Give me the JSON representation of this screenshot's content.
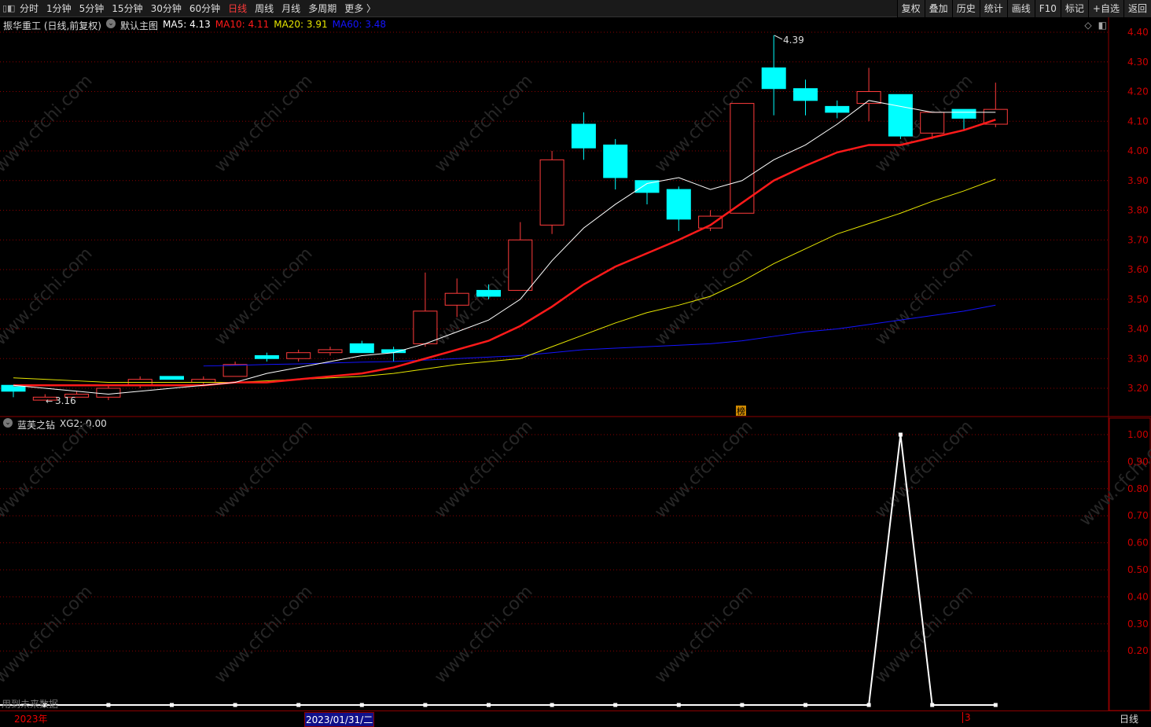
{
  "toolbar": {
    "periods": [
      "分时",
      "1分钟",
      "5分钟",
      "15分钟",
      "30分钟",
      "60分钟",
      "日线",
      "周线",
      "月线",
      "多周期",
      "更多 〉"
    ],
    "active": "日线",
    "right": [
      "复权",
      "叠加",
      "历史",
      "统计",
      "画线",
      "F10",
      "标记",
      "+自选",
      "返回"
    ]
  },
  "legend": {
    "title": "振华重工 (日线,前复权)",
    "main": "默认主图",
    "ma5": "MA5: 4.13",
    "ma10": "MA10: 4.11",
    "ma20": "MA20: 3.91",
    "ma60": "MA60: 3.48"
  },
  "colors": {
    "up": "#ff3b3b",
    "down": "#00ffff",
    "ma5": "#ffffff",
    "ma10": "#ff1a1a",
    "ma20": "#e6e600",
    "ma60": "#1414ff",
    "grid": "#8b0000"
  },
  "price_axis": [
    "4.40",
    "4.30",
    "4.20",
    "4.10",
    "4.00",
    "3.90",
    "3.80",
    "3.70",
    "3.60",
    "3.50",
    "3.40",
    "3.30",
    "3.20"
  ],
  "annotations": {
    "high": "4.39",
    "low": "3.16",
    "marker": "榜"
  },
  "indicator": {
    "name": "蓝芙之钻",
    "value": "XG2: 0.00",
    "axis": [
      "1.00",
      "0.90",
      "0.80",
      "0.70",
      "0.60",
      "0.50",
      "0.40",
      "0.30",
      "0.20"
    ],
    "note": "用到未来数据"
  },
  "bottom": {
    "year": "2023年",
    "cursor_date": "2023/01/31/二",
    "month": "3",
    "period": "日线"
  },
  "watermark": "www.cfchi.com",
  "chart_data": {
    "type": "candlestick",
    "ohlc": [
      [
        3.21,
        3.21,
        3.17,
        3.19
      ],
      [
        3.16,
        3.18,
        3.16,
        3.17
      ],
      [
        3.17,
        3.19,
        3.17,
        3.18
      ],
      [
        3.17,
        3.21,
        3.16,
        3.2
      ],
      [
        3.21,
        3.24,
        3.2,
        3.23
      ],
      [
        3.24,
        3.24,
        3.23,
        3.23
      ],
      [
        3.22,
        3.24,
        3.21,
        3.23
      ],
      [
        3.24,
        3.29,
        3.24,
        3.28
      ],
      [
        3.31,
        3.32,
        3.29,
        3.3
      ],
      [
        3.3,
        3.33,
        3.29,
        3.32
      ],
      [
        3.32,
        3.34,
        3.31,
        3.33
      ],
      [
        3.35,
        3.36,
        3.32,
        3.32
      ],
      [
        3.33,
        3.34,
        3.29,
        3.32
      ],
      [
        3.35,
        3.59,
        3.34,
        3.46
      ],
      [
        3.48,
        3.57,
        3.44,
        3.52
      ],
      [
        3.53,
        3.55,
        3.5,
        3.51
      ],
      [
        3.53,
        3.76,
        3.53,
        3.7
      ],
      [
        3.75,
        4.0,
        3.72,
        3.97
      ],
      [
        4.09,
        4.13,
        3.97,
        4.01
      ],
      [
        4.02,
        4.04,
        3.87,
        3.91
      ],
      [
        3.9,
        3.9,
        3.82,
        3.86
      ],
      [
        3.87,
        3.88,
        3.73,
        3.77
      ],
      [
        3.74,
        3.8,
        3.73,
        3.78
      ],
      [
        3.79,
        4.16,
        3.79,
        4.16
      ],
      [
        4.28,
        4.39,
        4.12,
        4.21
      ],
      [
        4.21,
        4.24,
        4.12,
        4.17
      ],
      [
        4.15,
        4.17,
        4.11,
        4.13
      ],
      [
        4.16,
        4.28,
        4.1,
        4.2
      ],
      [
        4.19,
        4.19,
        4.04,
        4.05
      ],
      [
        4.06,
        4.13,
        4.04,
        4.13
      ],
      [
        4.14,
        4.14,
        4.07,
        4.11
      ],
      [
        4.09,
        4.23,
        4.08,
        4.14
      ]
    ],
    "ma5": [
      3.21,
      3.2,
      3.19,
      3.18,
      3.19,
      3.2,
      3.21,
      3.22,
      3.25,
      3.27,
      3.29,
      3.31,
      3.32,
      3.35,
      3.39,
      3.43,
      3.5,
      3.63,
      3.74,
      3.82,
      3.89,
      3.91,
      3.87,
      3.9,
      3.97,
      4.02,
      4.09,
      4.17,
      4.15,
      4.13,
      4.13,
      4.13
    ],
    "ma10": [
      3.21,
      3.21,
      3.21,
      3.21,
      3.21,
      3.21,
      3.21,
      3.22,
      3.22,
      3.23,
      3.24,
      3.25,
      3.27,
      3.3,
      3.33,
      3.36,
      3.41,
      3.475,
      3.55,
      3.61,
      3.655,
      3.7,
      3.75,
      3.825,
      3.9,
      3.95,
      3.995,
      4.02,
      4.02,
      4.045,
      4.07,
      4.105
    ],
    "ma20": [
      3.235,
      3.23,
      3.225,
      3.22,
      3.22,
      3.22,
      3.22,
      3.22,
      3.225,
      3.23,
      3.235,
      3.24,
      3.25,
      3.265,
      3.28,
      3.29,
      3.3,
      3.34,
      3.38,
      3.42,
      3.455,
      3.48,
      3.51,
      3.56,
      3.62,
      3.67,
      3.72,
      3.755,
      3.79,
      3.83,
      3.865,
      3.905
    ],
    "ma60": [
      null,
      null,
      null,
      null,
      null,
      null,
      3.275,
      3.277,
      3.28,
      3.282,
      3.285,
      3.288,
      3.29,
      3.295,
      3.3,
      3.305,
      3.31,
      3.32,
      3.33,
      3.335,
      3.34,
      3.345,
      3.35,
      3.36,
      3.375,
      3.39,
      3.4,
      3.415,
      3.43,
      3.445,
      3.46,
      3.48
    ],
    "xg2": [
      0,
      0,
      0,
      0,
      0,
      0,
      0,
      0,
      0,
      0,
      0,
      0,
      0,
      0,
      0,
      0,
      0,
      0,
      0,
      0,
      0,
      0,
      0,
      0,
      0,
      0,
      0,
      0,
      1,
      0,
      0,
      0
    ],
    "ylim": [
      3.2,
      4.4
    ],
    "indicator_ylim": [
      0,
      1
    ]
  }
}
